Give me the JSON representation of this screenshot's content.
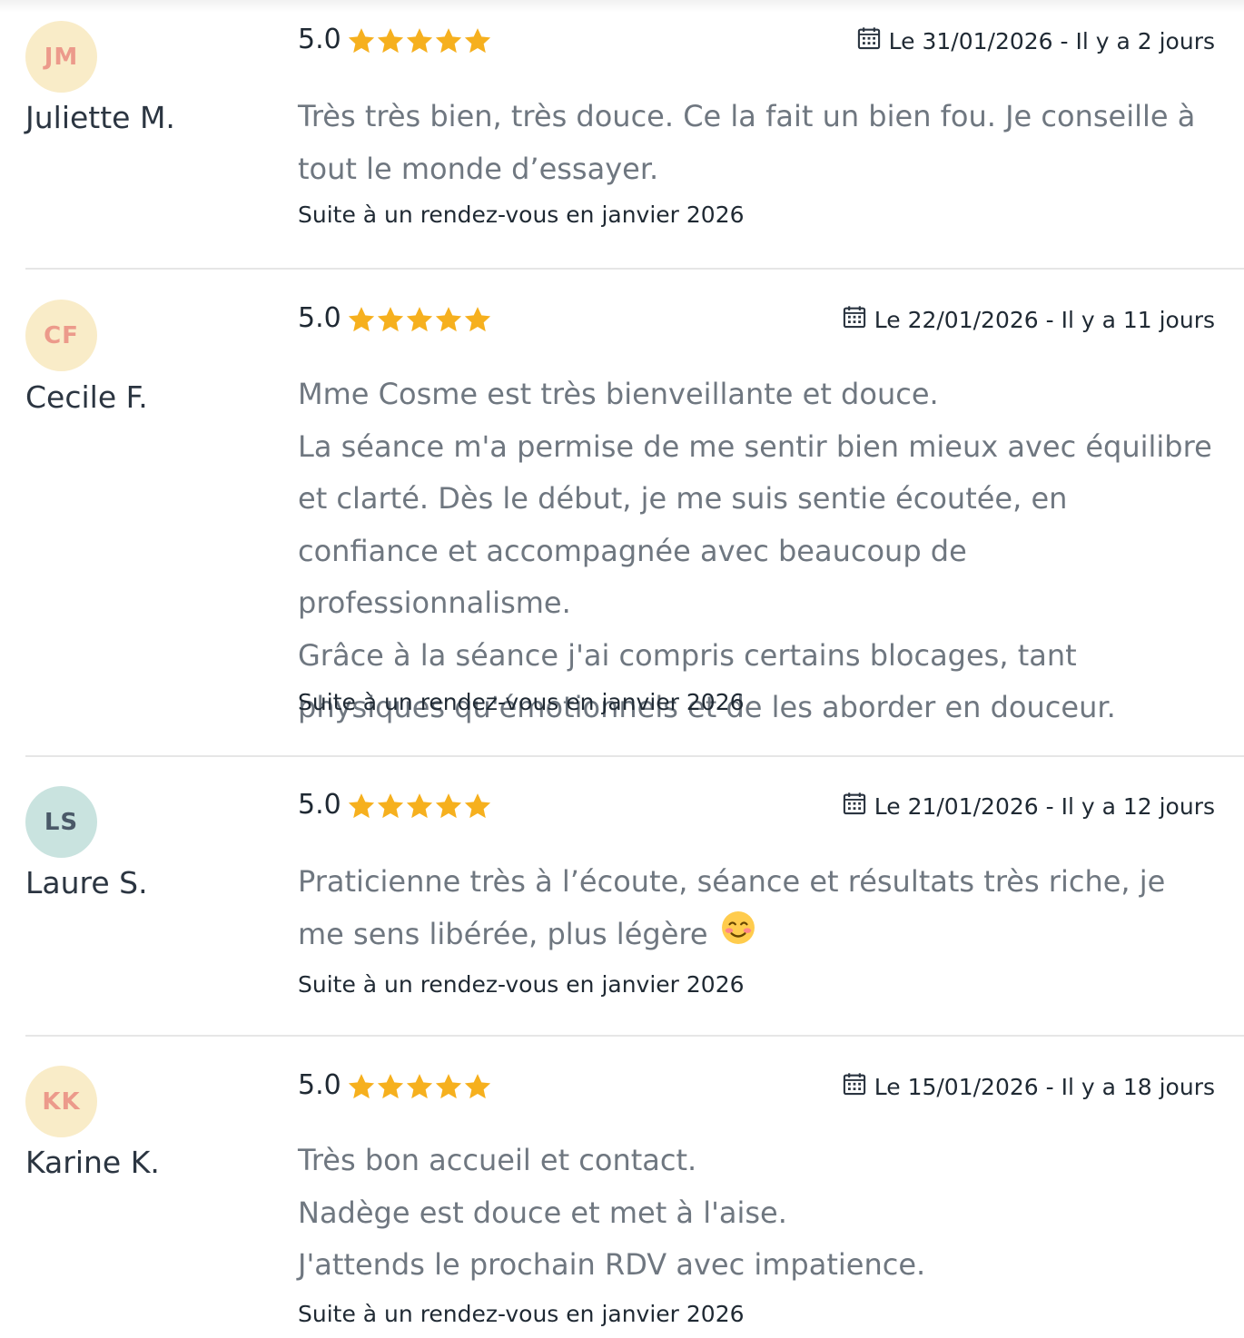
{
  "colors": {
    "star": "#f6b01e",
    "avatar_yellow_bg": "#f9ecc8",
    "avatar_yellow_text": "#ec9a8b",
    "avatar_teal_bg": "#c9e3df",
    "avatar_teal_text": "#4a5968",
    "divider": "#e6e6e6",
    "body_text": "#6f7780"
  },
  "reviews": [
    {
      "initials": "JM",
      "author": "Juliette M.",
      "score": "5.0",
      "stars": 5,
      "date": "Le 31/01/2026 - Il y a 2 jours",
      "body_lines": [
        "Très très bien, très douce. Ce la fait un bien fou. Je conseille à tout le monde d’essayer."
      ],
      "context": "Suite à un rendez-vous en janvier 2026",
      "avatar_icon": "avatar-initials"
    },
    {
      "initials": "CF",
      "author": "Cecile F.",
      "score": "5.0",
      "stars": 5,
      "date": "Le 22/01/2026 - Il y a 11 jours",
      "body_lines": [
        "Mme Cosme est très bienveillante et douce.",
        "La séance m'a permise de me sentir bien mieux avec équilibre et clarté. Dès le début, je me suis sentie écoutée, en confiance et accompagnée avec beaucoup de professionnalisme.",
        "Grâce à la séance j'ai compris certains blocages, tant physiques qu'émotionnels et de les aborder en douceur."
      ],
      "context": "Suite à un rendez-vous en janvier 2026"
    },
    {
      "initials": "LS",
      "author": "Laure S.",
      "score": "5.0",
      "stars": 5,
      "date": "Le 21/01/2026 - Il y a 12 jours",
      "body_lines": [
        "Praticienne très à l’écoute, séance et résultats très riche, je me sens libérée, plus légère"
      ],
      "emoji": "smiling-face-blush-icon",
      "context": "Suite à un rendez-vous en janvier 2026"
    },
    {
      "initials": "KK",
      "author": "Karine K.",
      "score": "5.0",
      "stars": 5,
      "date": "Le 15/01/2026 - Il y a 18 jours",
      "body_lines": [
        "Très bon accueil et contact.",
        "Nadège est douce et met à l'aise.",
        "J'attends le prochain RDV avec impatience."
      ],
      "context": "Suite à un rendez-vous en janvier 2026"
    }
  ]
}
